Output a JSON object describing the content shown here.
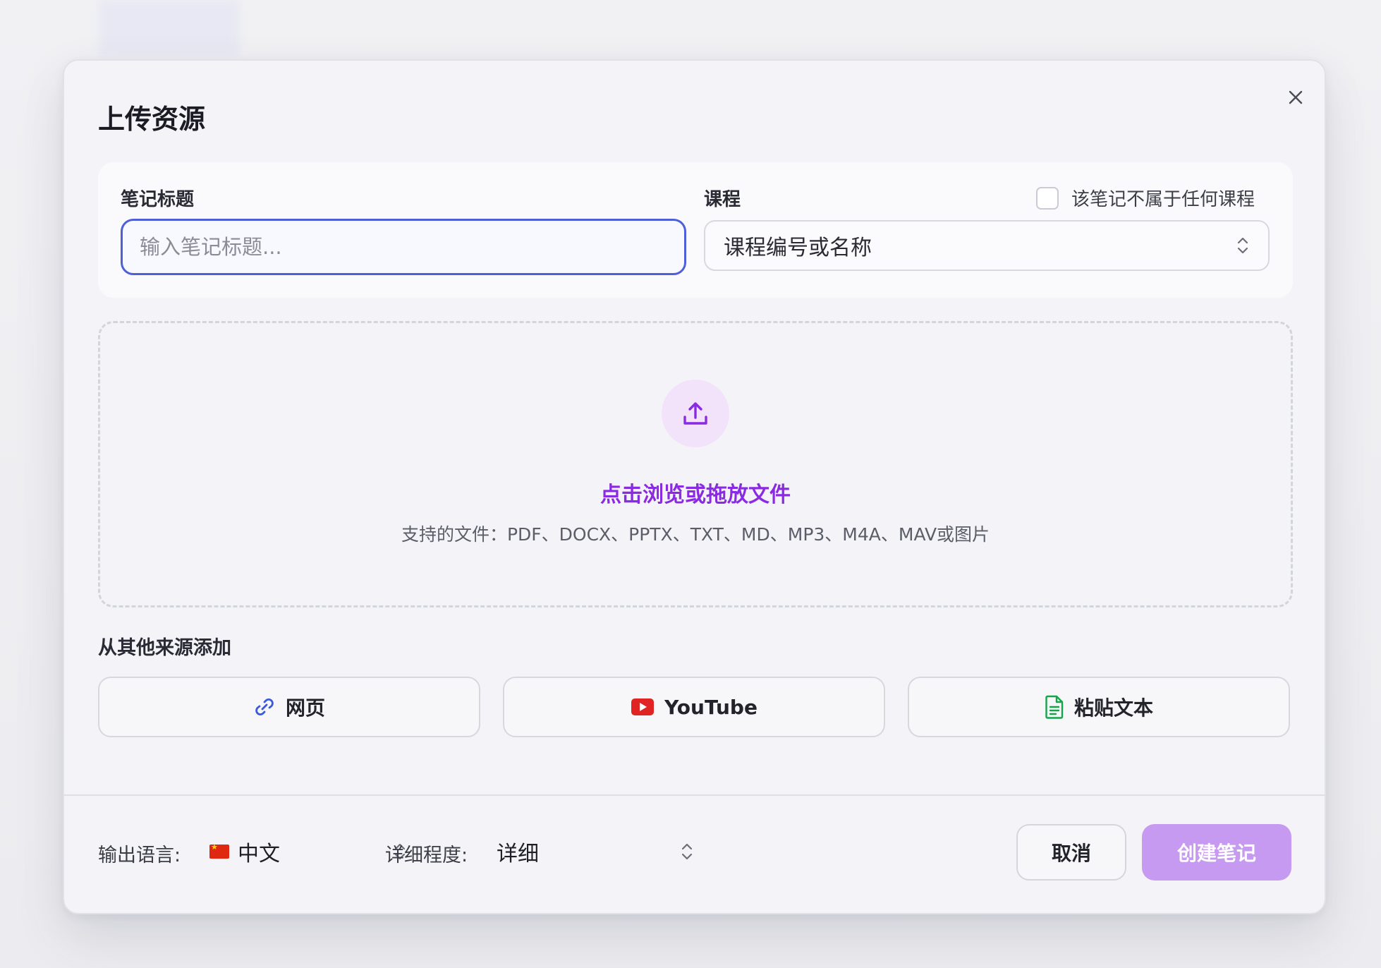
{
  "modal": {
    "title": "上传资源"
  },
  "form": {
    "note_title_label": "笔记标题",
    "note_title_placeholder": "输入笔记标题...",
    "course_label": "课程",
    "no_course_checkbox_label": "该笔记不属于任何课程",
    "no_course_checked": false,
    "course_placeholder": "课程编号或名称"
  },
  "dropzone": {
    "main_text": "点击浏览或拖放文件",
    "supported_text": "支持的文件：PDF、DOCX、PPTX、TXT、MD、MP3、M4A、MAV或图片",
    "icon": "upload-icon"
  },
  "other_sources": {
    "label": "从其他来源添加",
    "buttons": [
      {
        "label": "网页",
        "icon": "link-icon",
        "color": "#3b5bdb"
      },
      {
        "label": "YouTube",
        "icon": "youtube-icon",
        "color": "#e02424"
      },
      {
        "label": "粘贴文本",
        "icon": "document-icon",
        "color": "#16a34a"
      }
    ]
  },
  "footer": {
    "language_label": "输出语言:",
    "language_value": "中文",
    "language_flag": "china-flag-icon",
    "detail_label": "详细程度:",
    "detail_value": "详细",
    "cancel_label": "取消",
    "create_label": "创建笔记"
  },
  "colors": {
    "accent_purple": "#8a2be2",
    "create_button": "#c69af0",
    "input_focus_border": "#4f5fd8"
  }
}
